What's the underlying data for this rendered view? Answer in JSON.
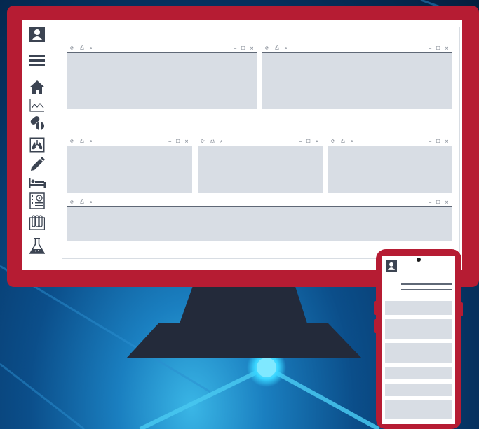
{
  "illustration": {
    "colors": {
      "frame": "#b61c33",
      "screen": "#ffffff",
      "panel": "#d8dde4",
      "panel_line": "#5f6876",
      "stand": "#232a3a",
      "icon": "#3c4452"
    },
    "sidebar_icons": [
      "user-icon",
      "menu-icon",
      "home-icon",
      "chart-icon",
      "pills-icon",
      "lungs-icon",
      "pencil-icon",
      "bed-icon",
      "record-icon",
      "test-tubes-icon",
      "flask-icon"
    ],
    "panel_toolbar": {
      "left_glyphs": "⟳ ⎙ ⌕",
      "right_glyphs": "‒ ☐ ×"
    },
    "phone": {
      "icon": "user-icon",
      "rows": 6
    }
  }
}
